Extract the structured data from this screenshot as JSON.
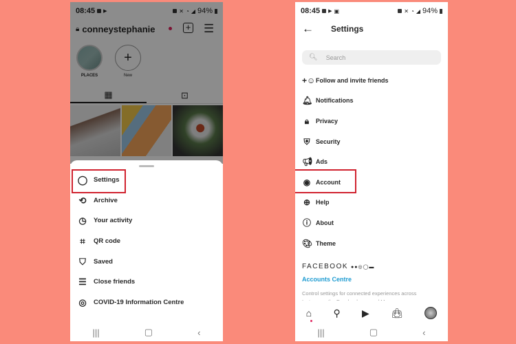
{
  "background_color": "#fa8a7a",
  "highlight_color": "#d0212e",
  "left_phone": {
    "status_bar": {
      "time": "08:45",
      "battery": "94%"
    },
    "profile": {
      "username": "conneystephanie",
      "highlights": [
        {
          "label": "PLACES"
        },
        {
          "label": "New"
        }
      ]
    },
    "menu": {
      "items": [
        {
          "label": "Settings",
          "icon": "settings-icon",
          "highlighted": true
        },
        {
          "label": "Archive",
          "icon": "archive-icon"
        },
        {
          "label": "Your activity",
          "icon": "activity-icon"
        },
        {
          "label": "QR code",
          "icon": "qr-code-icon"
        },
        {
          "label": "Saved",
          "icon": "bookmark-icon"
        },
        {
          "label": "Close friends",
          "icon": "list-icon"
        },
        {
          "label": "COVID-19 Information Centre",
          "icon": "covid-info-icon"
        }
      ]
    }
  },
  "right_phone": {
    "status_bar": {
      "time": "08:45",
      "battery": "94%"
    },
    "header": {
      "title": "Settings"
    },
    "search": {
      "placeholder": "Search"
    },
    "items": [
      {
        "label": "Follow and invite friends",
        "icon": "add-person-icon"
      },
      {
        "label": "Notifications",
        "icon": "bell-icon"
      },
      {
        "label": "Privacy",
        "icon": "lock-icon"
      },
      {
        "label": "Security",
        "icon": "shield-icon"
      },
      {
        "label": "Ads",
        "icon": "megaphone-icon"
      },
      {
        "label": "Account",
        "icon": "account-icon",
        "highlighted": true
      },
      {
        "label": "Help",
        "icon": "lifebuoy-icon"
      },
      {
        "label": "About",
        "icon": "info-icon"
      },
      {
        "label": "Theme",
        "icon": "palette-icon"
      }
    ],
    "facebook_section": {
      "heading": "FACEBOOK",
      "link": "Accounts Centre",
      "description": "Control settings for connected experiences across Instagram, the Facebook app and Messenger."
    }
  }
}
